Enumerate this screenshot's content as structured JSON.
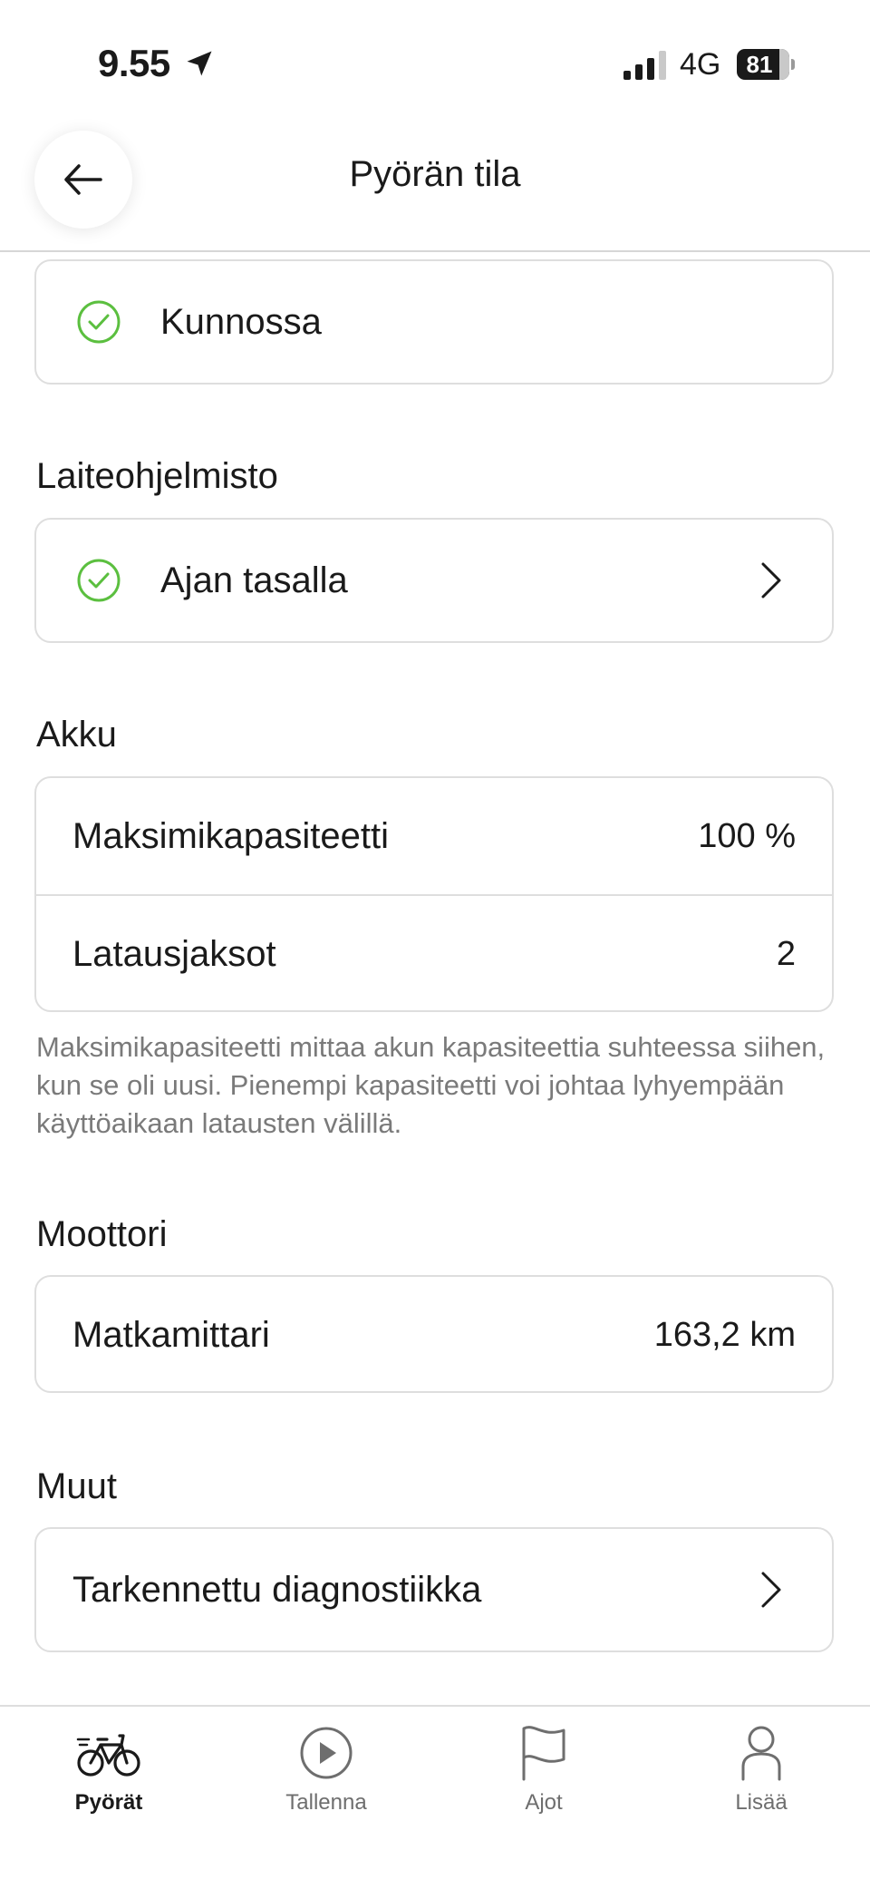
{
  "status_bar": {
    "time": "9.55",
    "network": "4G",
    "battery": "81",
    "battery_level": 0.81
  },
  "header": {
    "title": "Pyörän tila"
  },
  "status_card": {
    "label": "Kunnossa"
  },
  "firmware": {
    "heading": "Laiteohjelmisto",
    "label": "Ajan tasalla"
  },
  "battery_section": {
    "heading": "Akku",
    "rows": [
      {
        "label": "Maksimikapasiteetti",
        "value": "100 %"
      },
      {
        "label": "Latausjaksot",
        "value": "2"
      }
    ],
    "note": "Maksimikapasiteetti mittaa akun kapasiteettia suhteessa siihen, kun se oli uusi. Pienempi kapasiteetti voi johtaa lyhyempään käyttöaikaan latausten välillä."
  },
  "motor_section": {
    "heading": "Moottori",
    "label": "Matkamittari",
    "value": "163,2 km"
  },
  "other_section": {
    "heading": "Muut",
    "label": "Tarkennettu diagnostiikka"
  },
  "tab_bar": {
    "tabs": [
      {
        "label": "Pyörät",
        "icon": "bike-icon",
        "active": true
      },
      {
        "label": "Tallenna",
        "icon": "play-icon",
        "active": false
      },
      {
        "label": "Ajot",
        "icon": "flag-icon",
        "active": false
      },
      {
        "label": "Lisää",
        "icon": "person-icon",
        "active": false
      }
    ]
  },
  "colors": {
    "accent_green": "#5bbf3f",
    "text": "#1a1a1a",
    "muted": "#7a7a7a",
    "border": "#dedede"
  }
}
